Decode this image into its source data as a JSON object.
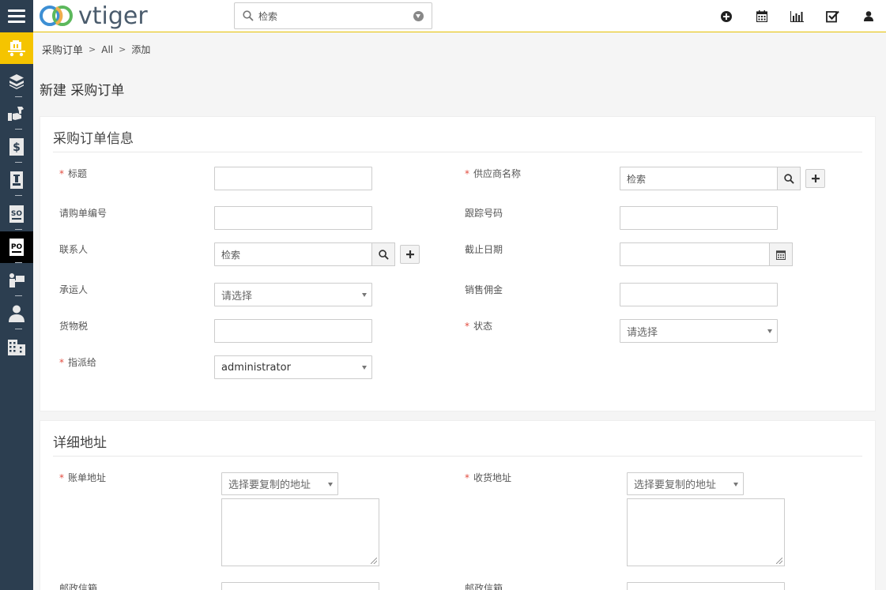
{
  "app": {
    "logo_text": "vtiger"
  },
  "search": {
    "placeholder": "检索"
  },
  "top_icons": [
    "plus-circle-icon",
    "calendar-icon",
    "bar-chart-icon",
    "checkbox-icon",
    "user-icon"
  ],
  "sidebar": {
    "items": [
      {
        "name": "purchase-module-icon",
        "state": "active-yellow"
      },
      {
        "name": "products-icon"
      },
      {
        "name": "services-icon"
      },
      {
        "name": "quotes-icon"
      },
      {
        "name": "invoice-icon"
      },
      {
        "name": "sales-order-icon",
        "label": "SO"
      },
      {
        "name": "purchase-order-icon",
        "label": "PO",
        "state": "active-black"
      },
      {
        "name": "vendors-icon"
      },
      {
        "name": "contacts-icon"
      },
      {
        "name": "organizations-icon"
      }
    ]
  },
  "breadcrumb": {
    "module": "采购订单",
    "filter": "All",
    "action": "添加"
  },
  "page": {
    "title": "新建 采购订单"
  },
  "section1": {
    "title": "采购订单信息",
    "fields": {
      "subject": {
        "label": "标题",
        "required": true,
        "value": ""
      },
      "vendor": {
        "label": "供应商名称",
        "required": true,
        "placeholder": "检索"
      },
      "requisition_no": {
        "label": "请购单编号",
        "value": ""
      },
      "tracking_no": {
        "label": "跟踪号码",
        "value": ""
      },
      "contact": {
        "label": "联系人",
        "placeholder": "检索"
      },
      "due_date": {
        "label": "截止日期",
        "value": ""
      },
      "carrier": {
        "label": "承运人",
        "value": "请选择"
      },
      "sales_commission": {
        "label": "销售佣金",
        "value": ""
      },
      "excise_tax": {
        "label": "货物税",
        "value": ""
      },
      "status": {
        "label": "状态",
        "required": true,
        "value": "请选择"
      },
      "assigned_to": {
        "label": "指派给",
        "required": true,
        "value": "administrator"
      }
    }
  },
  "section2": {
    "title": "详细地址",
    "fields": {
      "billing_address": {
        "label": "账单地址",
        "required": true,
        "copy_select": "选择要复制的地址"
      },
      "shipping_address": {
        "label": "收货地址",
        "required": true,
        "copy_select": "选择要复制的地址"
      },
      "billing_pobox": {
        "label": "邮政信箱"
      },
      "shipping_pobox": {
        "label": "邮政信箱"
      }
    }
  },
  "colors": {
    "accent": "#f5c400",
    "sidebar": "#2c3e50",
    "required": "#e24c3f"
  }
}
